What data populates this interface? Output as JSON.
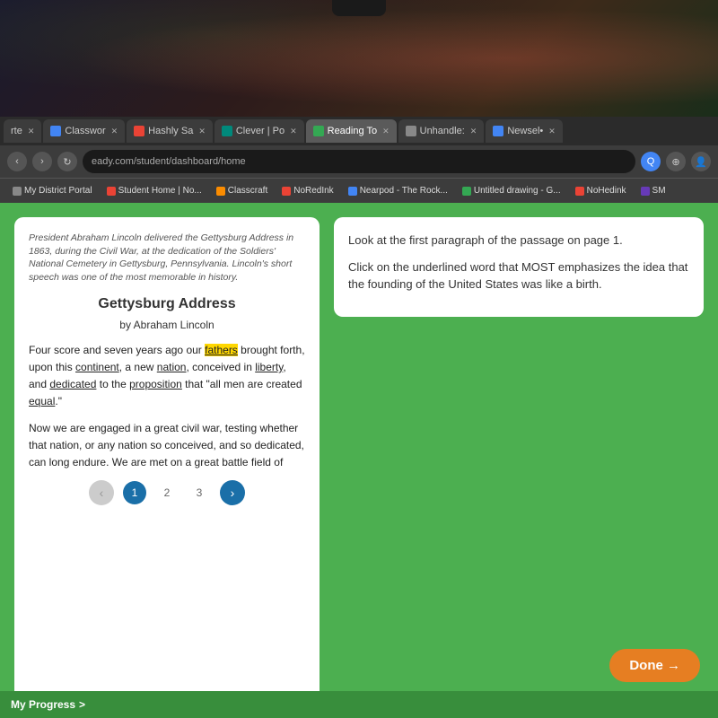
{
  "top_photo": {
    "alt": "Blurred background photo of desk area"
  },
  "browser": {
    "tabs": [
      {
        "id": "tab1",
        "label": "rte",
        "active": false,
        "favicon_color": "gray",
        "has_close": true
      },
      {
        "id": "tab2",
        "label": "Classwor",
        "active": false,
        "favicon_color": "blue",
        "has_close": true
      },
      {
        "id": "tab3",
        "label": "Hashly Sa",
        "active": false,
        "favicon_color": "red",
        "has_close": true
      },
      {
        "id": "tab4",
        "label": "Clever | Po",
        "active": false,
        "favicon_color": "teal",
        "has_close": true
      },
      {
        "id": "tab5",
        "label": "Reading To",
        "active": true,
        "favicon_color": "green",
        "has_close": true
      },
      {
        "id": "tab6",
        "label": "Unhandle:",
        "active": false,
        "favicon_color": "gray",
        "has_close": true
      },
      {
        "id": "tab7",
        "label": "Newsel•",
        "active": false,
        "favicon_color": "blue",
        "has_close": true
      }
    ],
    "address_bar": {
      "url": "eady.com/student/dashboard/home"
    },
    "bookmarks": [
      {
        "label": "My District Portal",
        "favicon_color": "gray"
      },
      {
        "label": "Student Home | No...",
        "favicon_color": "red"
      },
      {
        "label": "Classcraft",
        "favicon_color": "orange"
      },
      {
        "label": "NoRedInk",
        "favicon_color": "red"
      },
      {
        "label": "Nearpod - The Rock...",
        "favicon_color": "blue"
      },
      {
        "label": "Untitled drawing - G...",
        "favicon_color": "green"
      },
      {
        "label": "NoHedink",
        "favicon_color": "red"
      },
      {
        "label": "SM",
        "favicon_color": "purple"
      }
    ]
  },
  "reading": {
    "passage": {
      "intro": "President Abraham Lincoln delivered the Gettysburg Address in 1863, during the Civil War, at the dedication of the Soldiers' National Cemetery in Gettysburg, Pennsylvania. Lincoln's short speech was one of the most memorable in history.",
      "title": "Gettysburg Address",
      "author": "by Abraham Linco​ln",
      "paragraph1": "Four score and seven years ago",
      "p1_after_ago": " our ",
      "p1_fathers": "fathers",
      "p1_after_fathers": " brought forth, upon this ",
      "p1_continent": "continent",
      "p1_rest1": ", a new ",
      "p1_nation": "nation",
      "p1_rest2": ", conceived in ",
      "p1_liberty": "liberty",
      "p1_rest3": ", and ",
      "p1_dedicated": "dedicated",
      "p1_rest4": " to the ",
      "p1_proposition": "proposition",
      "p1_rest5": " that \"all men are created ",
      "p1_equal": "equal",
      "p1_end": ".\"",
      "paragraph2": "Now we are engaged in a great civil war, testing whether that nation, or any nation so conceived, and so dedicated, can long endure. We are met on a great battle field of",
      "pages": [
        "1",
        "2",
        "3"
      ],
      "current_page": 0
    },
    "question": {
      "instruction": "Look at the first paragraph of the passage on page 1.",
      "text": "Click on the underlined word that MOST emphasizes the idea that the founding of the United States was like a birth."
    },
    "done_button": "Done →",
    "progress": {
      "label": "My Progress",
      "icon": ">"
    }
  }
}
